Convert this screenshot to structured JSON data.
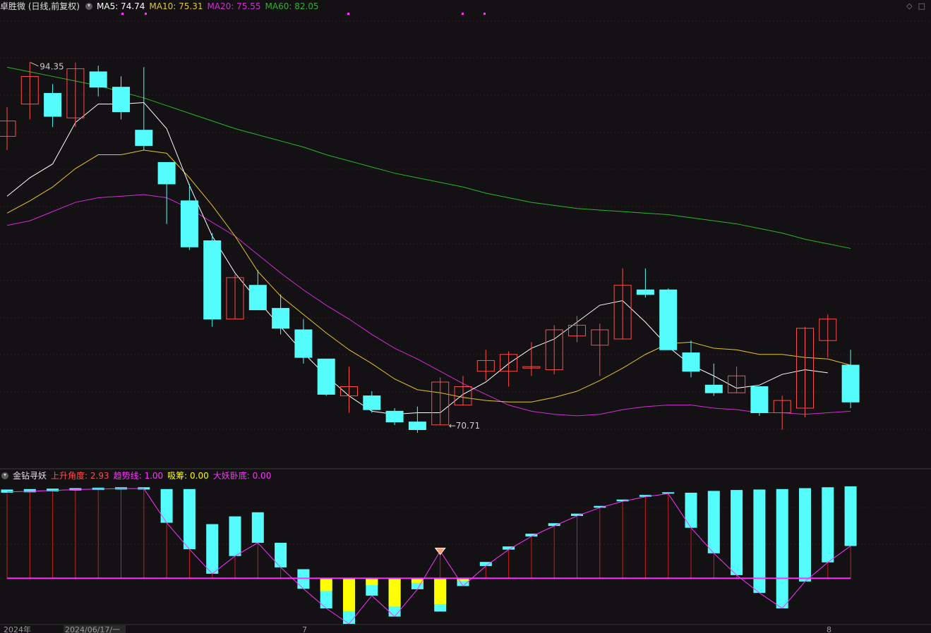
{
  "header": {
    "title": "卓胜微 (日线,前复权)",
    "ma5": "MA5: 74.74",
    "ma10": "MA10: 75.31",
    "ma20": "MA20: 75.55",
    "ma60": "MA60: 82.05"
  },
  "indicator_header": {
    "title": "金钻寻妖",
    "up_angle": "上升角度: 2.93",
    "trend_line": "趋势线: 1.00",
    "absorb": "吸筹: 0.00",
    "demon_bottom": "大妖卧底: 0.00"
  },
  "colors": {
    "bg": "#131113",
    "grid": "#3a1a1a",
    "up": "#ff4d4d",
    "down": "#54fcfc",
    "ma5": "#ffffff",
    "ma10": "#e6c332",
    "ma20": "#d62bd6",
    "ma60": "#2bb52b",
    "absorb": "#ffff00",
    "trend": "#ff33ff"
  },
  "chart_data": [
    {
      "type": "candlestick",
      "y_range": [
        69.0,
        97.0
      ],
      "annotations": {
        "high_label": "94.35",
        "low_label": "70.71"
      },
      "candles": [
        {
          "o": 89.5,
          "c": 90.5,
          "h": 91.4,
          "l": 88.6
        },
        {
          "o": 91.6,
          "c": 93.4,
          "h": 94.35,
          "l": 90.6
        },
        {
          "o": 92.3,
          "c": 90.8,
          "h": 92.9,
          "l": 90.1
        },
        {
          "o": 90.7,
          "c": 93.9,
          "h": 94.3,
          "l": 90.1
        },
        {
          "o": 93.7,
          "c": 92.7,
          "h": 94.1,
          "l": 92.1
        },
        {
          "o": 92.7,
          "c": 91.1,
          "h": 93.4,
          "l": 90.6
        },
        {
          "o": 89.9,
          "c": 88.9,
          "h": 94.0,
          "l": 88.6
        },
        {
          "o": 87.8,
          "c": 86.4,
          "h": 87.8,
          "l": 83.8
        },
        {
          "o": 85.3,
          "c": 82.3,
          "h": 86.4,
          "l": 82.1
        },
        {
          "o": 82.7,
          "c": 77.6,
          "h": 83.2,
          "l": 77.1
        },
        {
          "o": 77.6,
          "c": 80.3,
          "h": 80.5,
          "l": 77.6
        },
        {
          "o": 79.8,
          "c": 78.2,
          "h": 80.8,
          "l": 78.2
        },
        {
          "o": 78.3,
          "c": 77.0,
          "h": 79.2,
          "l": 76.6
        },
        {
          "o": 76.9,
          "c": 75.1,
          "h": 77.6,
          "l": 74.7
        },
        {
          "o": 75.0,
          "c": 72.7,
          "h": 75.0,
          "l": 72.6
        },
        {
          "o": 72.6,
          "c": 73.2,
          "h": 74.5,
          "l": 71.5
        },
        {
          "o": 72.6,
          "c": 71.7,
          "h": 72.9,
          "l": 71.5
        },
        {
          "o": 71.6,
          "c": 70.9,
          "h": 71.8,
          "l": 70.7
        },
        {
          "o": 70.9,
          "c": 70.4,
          "h": 71.9,
          "l": 70.2
        },
        {
          "o": 70.71,
          "c": 73.5,
          "h": 73.8,
          "l": 70.7
        },
        {
          "o": 72.0,
          "c": 73.2,
          "h": 73.9,
          "l": 72.0
        },
        {
          "o": 74.2,
          "c": 74.9,
          "h": 75.6,
          "l": 73.6
        },
        {
          "o": 74.2,
          "c": 75.3,
          "h": 75.5,
          "l": 73.2
        },
        {
          "o": 74.5,
          "c": 74.5,
          "h": 76.1,
          "l": 73.9
        },
        {
          "o": 74.3,
          "c": 76.9,
          "h": 77.2,
          "l": 74.0
        },
        {
          "o": 76.5,
          "c": 77.2,
          "h": 77.8,
          "l": 76.1
        },
        {
          "o": 75.9,
          "c": 76.9,
          "h": 77.3,
          "l": 73.9
        },
        {
          "o": 76.3,
          "c": 79.8,
          "h": 80.9,
          "l": 76.3
        },
        {
          "o": 79.5,
          "c": 79.2,
          "h": 80.9,
          "l": 79.0
        },
        {
          "o": 79.5,
          "c": 75.6,
          "h": 79.6,
          "l": 75.6
        },
        {
          "o": 75.4,
          "c": 74.2,
          "h": 76.2,
          "l": 73.8
        },
        {
          "o": 73.3,
          "c": 72.8,
          "h": 74.7,
          "l": 72.6
        },
        {
          "o": 72.8,
          "c": 73.9,
          "h": 74.5,
          "l": 72.8
        },
        {
          "o": 73.2,
          "c": 71.5,
          "h": 73.2,
          "l": 71.3
        },
        {
          "o": 71.5,
          "c": 72.3,
          "h": 72.6,
          "l": 70.4
        },
        {
          "o": 71.8,
          "c": 77.0,
          "h": 77.1,
          "l": 71.2
        },
        {
          "o": 76.2,
          "c": 77.6,
          "h": 77.9,
          "l": 75.1
        },
        {
          "o": 74.6,
          "c": 72.2,
          "h": 75.6,
          "l": 71.8
        }
      ],
      "ma5": [
        85.6,
        86.8,
        87.7,
        90.4,
        91.6,
        91.6,
        91.7,
        90.0,
        86.3,
        83.0,
        80.6,
        78.8,
        77.1,
        75.4,
        73.9,
        72.6,
        71.6,
        71.4,
        71.5,
        71.5,
        72.7,
        73.5,
        74.7,
        75.7,
        76.3,
        77.4,
        78.5,
        78.8,
        77.4,
        75.8,
        74.6,
        73.9,
        73.1,
        73.3,
        74.0,
        74.3,
        74.1
      ],
      "ma10": [
        84.5,
        85.3,
        86.2,
        87.4,
        88.3,
        88.3,
        88.6,
        88.4,
        86.8,
        85.0,
        83.0,
        80.7,
        79.1,
        77.9,
        76.7,
        75.6,
        74.7,
        73.7,
        73.0,
        72.8,
        72.5,
        72.3,
        72.2,
        72.2,
        72.5,
        72.9,
        73.6,
        74.4,
        75.3,
        76.0,
        76.1,
        75.7,
        75.6,
        75.3,
        75.3,
        75.1,
        75.0,
        74.6
      ],
      "ma20": [
        83.7,
        84.0,
        84.6,
        85.2,
        85.5,
        85.6,
        85.7,
        85.5,
        84.8,
        83.9,
        83.0,
        81.8,
        80.6,
        79.5,
        78.5,
        77.6,
        76.6,
        75.7,
        75.0,
        74.2,
        73.4,
        72.7,
        72.0,
        71.6,
        71.4,
        71.3,
        71.4,
        71.7,
        71.9,
        72.0,
        72.0,
        71.8,
        71.7,
        71.5,
        71.5,
        71.4,
        71.5,
        71.6
      ],
      "ma60": [
        94.0,
        93.7,
        93.4,
        93.1,
        92.8,
        92.4,
        92.0,
        91.5,
        91.0,
        90.5,
        90.0,
        89.6,
        89.2,
        88.8,
        88.3,
        87.9,
        87.5,
        87.1,
        86.8,
        86.5,
        86.2,
        85.8,
        85.5,
        85.2,
        85.0,
        84.8,
        84.7,
        84.6,
        84.5,
        84.4,
        84.2,
        84.0,
        83.8,
        83.5,
        83.2,
        82.8,
        82.5,
        82.2
      ]
    },
    {
      "type": "bar",
      "y_range": [
        -1.0,
        2.05
      ],
      "baseline": 0,
      "bars": [
        {
          "top": 1.95,
          "bottom": 1.88,
          "color": "cyan"
        },
        {
          "top": 1.96,
          "bottom": 1.89,
          "color": "cyan"
        },
        {
          "top": 1.97,
          "bottom": 1.91,
          "color": "cyan"
        },
        {
          "top": 1.98,
          "bottom": 1.93,
          "color": "cyan"
        },
        {
          "top": 1.99,
          "bottom": 1.94,
          "color": "cyan"
        },
        {
          "top": 2.0,
          "bottom": 1.95,
          "color": "cyan"
        },
        {
          "top": 2.0,
          "bottom": 1.95,
          "color": "cyan"
        },
        {
          "top": 1.96,
          "bottom": 1.22,
          "color": "cyan"
        },
        {
          "top": 1.96,
          "bottom": 0.64,
          "color": "cyan"
        },
        {
          "top": 1.19,
          "bottom": 0.1,
          "color": "cyan"
        },
        {
          "top": 1.36,
          "bottom": 0.49,
          "color": "cyan"
        },
        {
          "top": 1.45,
          "bottom": 0.78,
          "color": "cyan"
        },
        {
          "top": 0.78,
          "bottom": 0.24,
          "color": "cyan"
        },
        {
          "top": 0.2,
          "bottom": -0.23,
          "color": "cyan"
        },
        {
          "top": -0.03,
          "bottom": -0.66,
          "color": "cyan",
          "yellow_top": 0.0,
          "yellow_bottom": -0.28
        },
        {
          "top": -0.0,
          "bottom": -1.0,
          "color": "cyan",
          "yellow_top": 0.0,
          "yellow_bottom": -0.72
        },
        {
          "top": -0.0,
          "bottom": -0.38,
          "color": "cyan",
          "yellow_top": 0.0,
          "yellow_bottom": -0.15
        },
        {
          "top": -0.0,
          "bottom": -0.84,
          "color": "cyan",
          "yellow_top": 0.0,
          "yellow_bottom": -0.62
        },
        {
          "top": -0.0,
          "bottom": -0.24,
          "color": "cyan",
          "yellow_top": 0.0,
          "yellow_bottom": -0.1
        },
        {
          "top": -0.0,
          "bottom": -0.73,
          "color": "cyan",
          "yellow_top": 0.0,
          "yellow_bottom": -0.57
        },
        {
          "top": 0.0,
          "bottom": -0.17,
          "color": "cyan",
          "yellow_top": 0.0,
          "yellow_bottom": -0.06
        },
        {
          "top": 0.36,
          "bottom": 0.27,
          "color": "cyan"
        },
        {
          "top": 0.7,
          "bottom": 0.63,
          "color": "cyan"
        },
        {
          "top": 0.98,
          "bottom": 0.92,
          "color": "cyan"
        },
        {
          "top": 1.21,
          "bottom": 1.15,
          "color": "cyan"
        },
        {
          "top": 1.42,
          "bottom": 1.37,
          "color": "cyan"
        },
        {
          "top": 1.59,
          "bottom": 1.55,
          "color": "cyan"
        },
        {
          "top": 1.73,
          "bottom": 1.69,
          "color": "cyan"
        },
        {
          "top": 1.83,
          "bottom": 1.79,
          "color": "cyan"
        },
        {
          "top": 1.89,
          "bottom": 1.86,
          "color": "cyan"
        },
        {
          "top": 1.88,
          "bottom": 1.11,
          "color": "cyan"
        },
        {
          "top": 1.92,
          "bottom": 0.55,
          "color": "cyan"
        },
        {
          "top": 1.94,
          "bottom": 0.07,
          "color": "cyan"
        },
        {
          "top": 1.95,
          "bottom": -0.32,
          "color": "cyan"
        },
        {
          "top": 1.96,
          "bottom": -0.66,
          "color": "cyan"
        },
        {
          "top": 1.98,
          "bottom": -0.07,
          "color": "cyan"
        },
        {
          "top": 2.0,
          "bottom": 0.35,
          "color": "cyan"
        },
        {
          "top": 2.02,
          "bottom": 0.71,
          "color": "cyan"
        }
      ],
      "trend_line": [
        1.9,
        1.91,
        1.93,
        1.95,
        1.96,
        1.97,
        1.97,
        1.22,
        0.64,
        0.1,
        0.49,
        0.78,
        0.24,
        -0.23,
        -0.66,
        -1.0,
        -0.38,
        -0.84,
        -0.24,
        0.6,
        -0.17,
        0.27,
        0.63,
        0.92,
        1.15,
        1.37,
        1.55,
        1.69,
        1.79,
        1.86,
        1.11,
        0.55,
        0.07,
        -0.32,
        -0.66,
        -0.07,
        0.35,
        0.71
      ],
      "diamond_index": 19
    }
  ],
  "axis": {
    "labels": [
      "2024年",
      "2024/06/17/一",
      "7",
      "8"
    ]
  },
  "top_icons": [
    "diamond-icon",
    "box-icon"
  ]
}
